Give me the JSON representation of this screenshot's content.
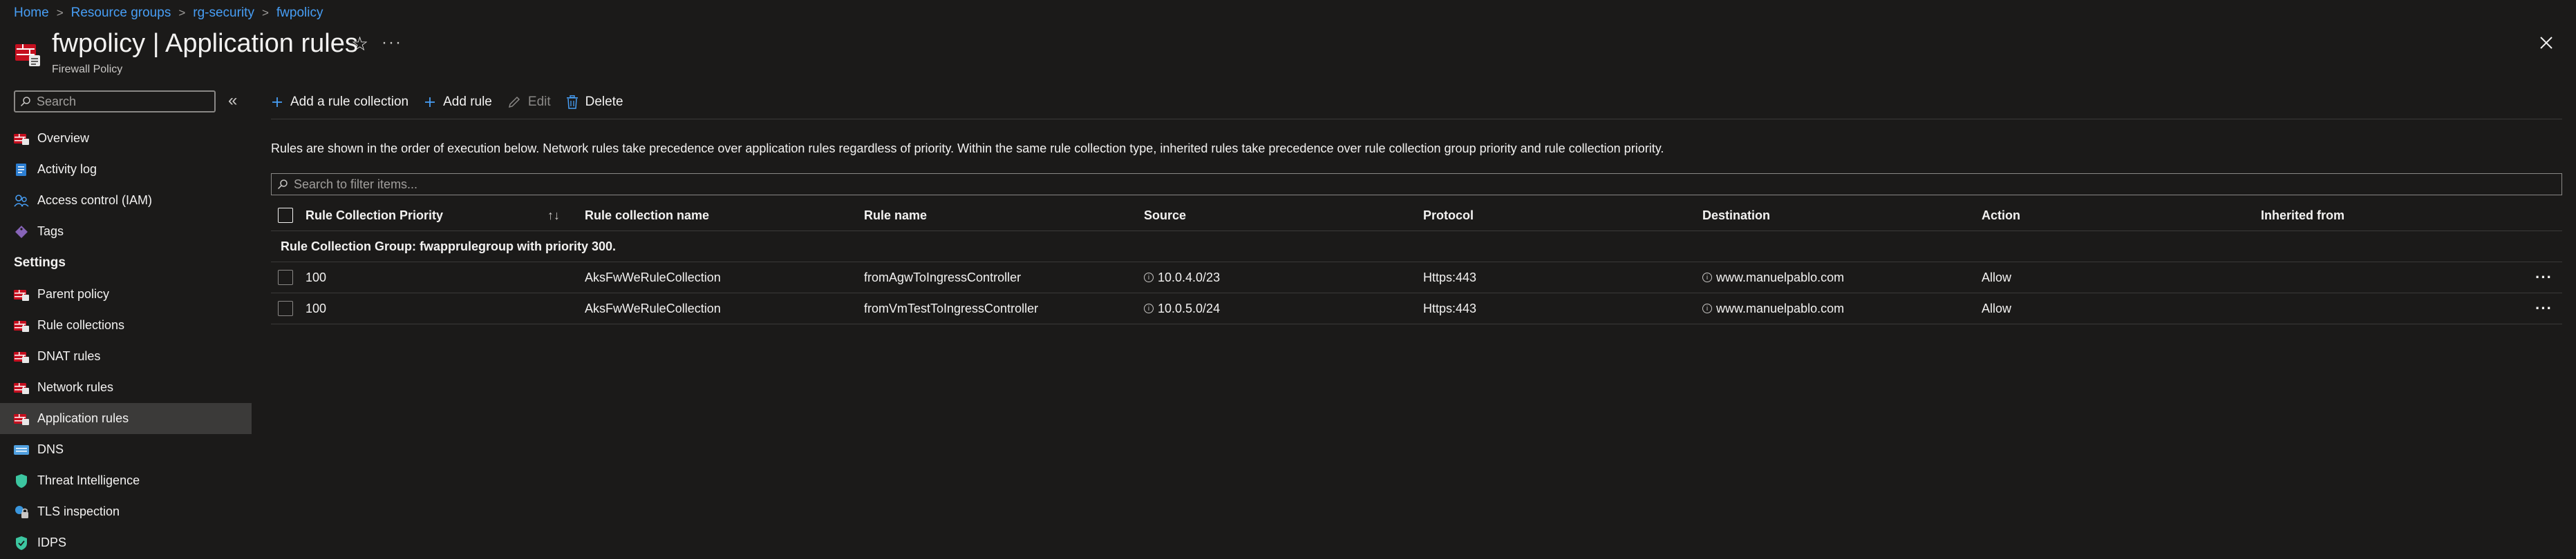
{
  "breadcrumb": [
    "Home",
    "Resource groups",
    "rg-security",
    "fwpolicy"
  ],
  "header": {
    "title": "fwpolicy | Application rules",
    "subtitle": "Firewall Policy",
    "favorite_icon": "star-icon",
    "more_label": "···",
    "close_icon": "close-icon"
  },
  "sidebar": {
    "search_placeholder": "Search",
    "collapse_label": "«",
    "items_top": [
      {
        "label": "Overview",
        "icon": "firewall-icon"
      },
      {
        "label": "Activity log",
        "icon": "log-icon"
      },
      {
        "label": "Access control (IAM)",
        "icon": "people-icon"
      },
      {
        "label": "Tags",
        "icon": "tag-icon"
      }
    ],
    "settings_heading": "Settings",
    "items_settings": [
      {
        "label": "Parent policy",
        "icon": "firewall-icon"
      },
      {
        "label": "Rule collections",
        "icon": "firewall-icon"
      },
      {
        "label": "DNAT rules",
        "icon": "firewall-icon"
      },
      {
        "label": "Network rules",
        "icon": "firewall-icon"
      },
      {
        "label": "Application rules",
        "icon": "firewall-icon",
        "active": true
      },
      {
        "label": "DNS",
        "icon": "dns-icon"
      },
      {
        "label": "Threat Intelligence",
        "icon": "shield-icon"
      },
      {
        "label": "TLS inspection",
        "icon": "tls-icon"
      },
      {
        "label": "IDPS",
        "icon": "shield-icon"
      }
    ]
  },
  "toolbar": {
    "add_collection": "Add a rule collection",
    "add_rule": "Add rule",
    "edit": "Edit",
    "delete": "Delete"
  },
  "info_text": "Rules are shown in the order of execution below. Network rules take precedence over application rules regardless of priority. Within the same rule collection type, inherited rules take precedence over rule collection group priority and rule collection priority.",
  "filter_placeholder": "Search to filter items...",
  "table": {
    "columns": {
      "priority": "Rule Collection Priority",
      "sort_glyph": "↑↓",
      "collection": "Rule collection name",
      "rule": "Rule name",
      "source": "Source",
      "protocol": "Protocol",
      "destination": "Destination",
      "action": "Action",
      "inherited": "Inherited from"
    },
    "group_label": "Rule Collection Group: fwapprulegroup with priority 300.",
    "rows": [
      {
        "priority": "100",
        "collection": "AksFwWeRuleCollection",
        "rule": "fromAgwToIngressController",
        "source": "10.0.4.0/23",
        "protocol": "Https:443",
        "destination": "www.manuelpablo.com",
        "action": "Allow",
        "inherited": ""
      },
      {
        "priority": "100",
        "collection": "AksFwWeRuleCollection",
        "rule": "fromVmTestToIngressController",
        "source": "10.0.5.0/24",
        "protocol": "Https:443",
        "destination": "www.manuelpablo.com",
        "action": "Allow",
        "inherited": ""
      }
    ],
    "row_more": "···"
  }
}
